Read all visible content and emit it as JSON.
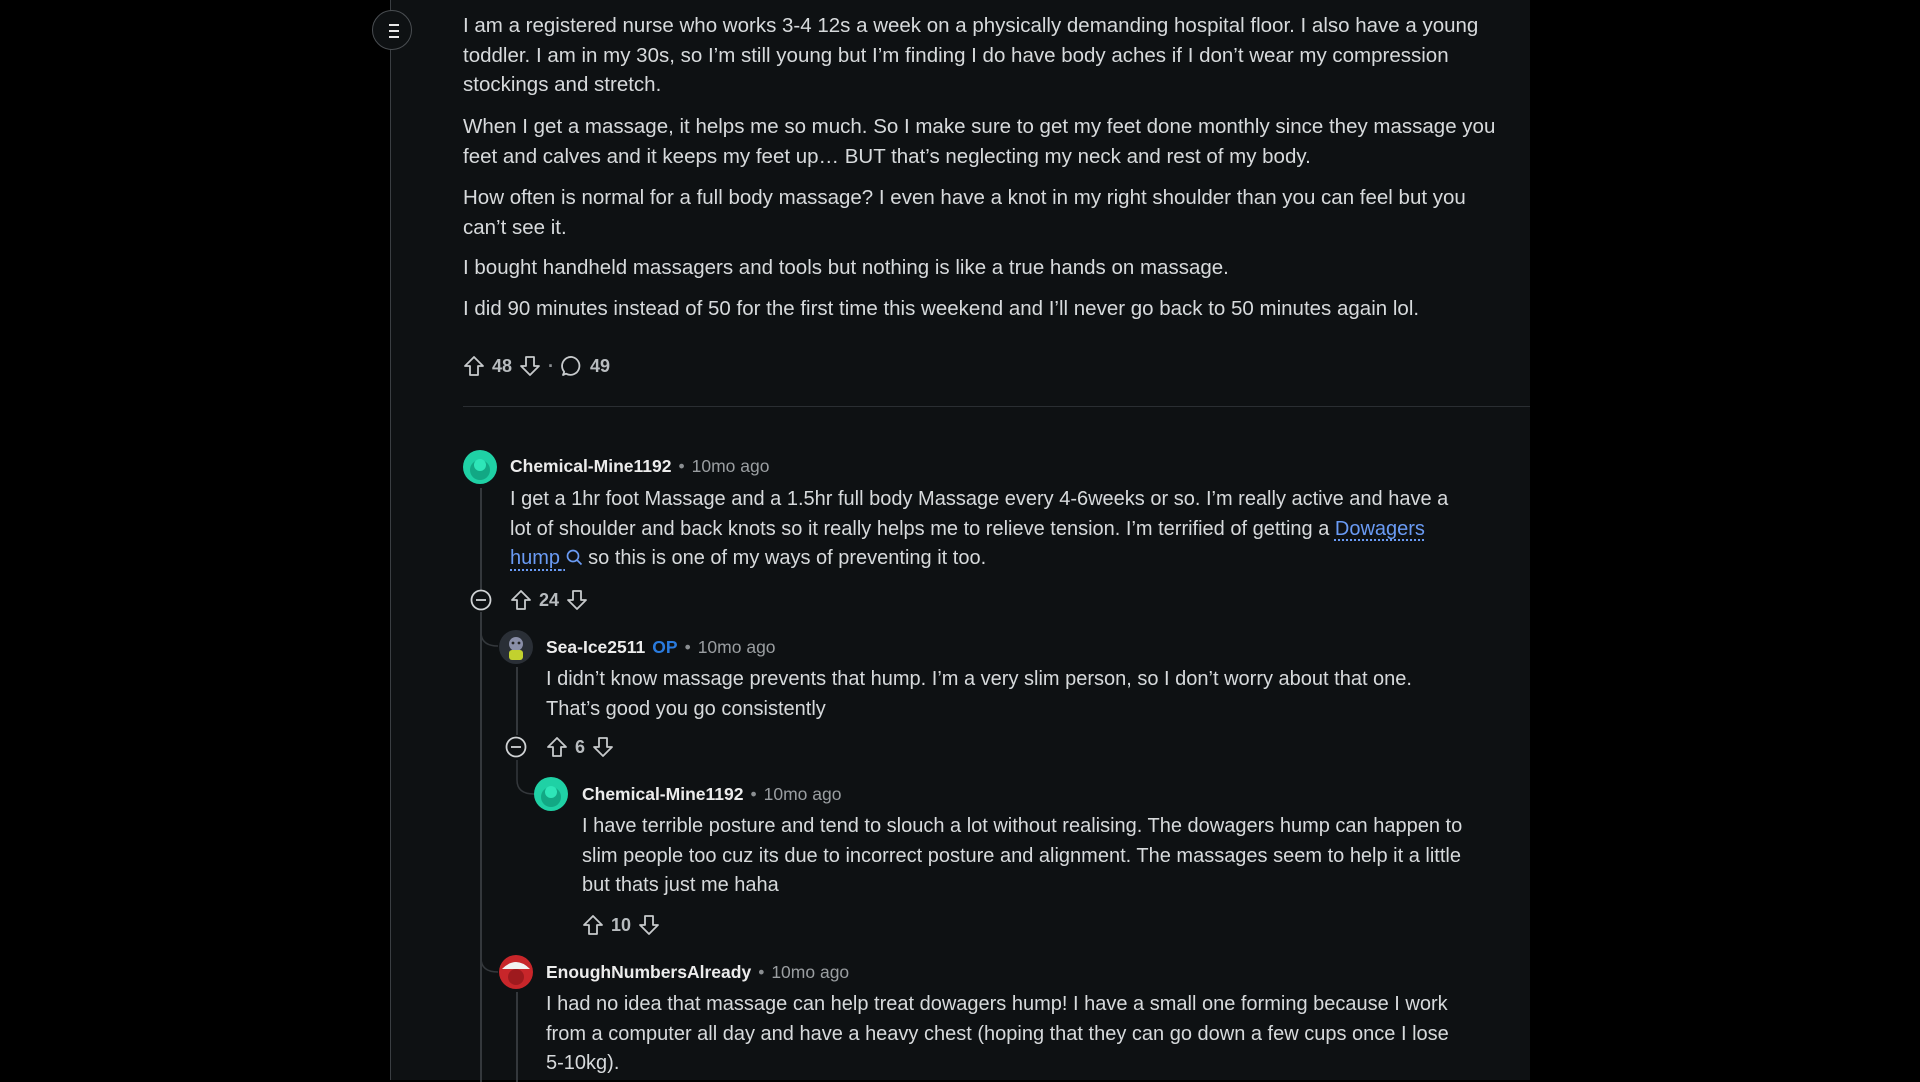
{
  "post": {
    "paragraphs": [
      [
        "I am a registered nurse who works 3-4 12s a week on a physically demanding hospital floor. I also have a young",
        "toddler. I am in my 30s, so I’m still young but I’m finding I do have body aches if I don’t wear my compression",
        "stockings and stretch."
      ],
      [
        "When I get a massage, it helps me so much. So I make sure to get my feet done monthly since they massage you",
        "feet and calves and it keeps my feet up… BUT that’s neglecting my neck and rest of my body."
      ],
      [
        "How often is normal for a full body massage? I even have a knot in my right shoulder than you can feel but you",
        "can’t see it."
      ],
      [
        "I bought handheld massagers and tools but nothing is like a true hands on massage."
      ],
      [
        "I did 90 minutes instead of 50 for the first time this weekend and I’ll never go back to 50 minutes again lol."
      ]
    ],
    "upvotes": "48",
    "separator": "·",
    "comments": "49"
  },
  "comments": [
    {
      "author": "Chemical-Mine1192",
      "time": "10mo ago",
      "lines": [
        "I get a 1hr foot Massage and a 1.5hr full body Massage every 4-6weeks or so. I’m really active and have a",
        "lot of shoulder and back knots so it really helps me to relieve tension. I’m terrified of getting a "
      ],
      "link_part1": "Dowagers",
      "link_part2": "hump",
      "line3_rest": " so this is one of my ways of preventing it too.",
      "votes": "24"
    },
    {
      "author": "Sea-Ice2511",
      "badge": "OP",
      "time": "10mo ago",
      "lines": [
        "I didn’t know massage prevents that hump. I’m a very slim person, so I don’t worry about that one.",
        "That’s good you go consistently"
      ],
      "votes": "6"
    },
    {
      "author": "Chemical-Mine1192",
      "time": "10mo ago",
      "lines": [
        "I have terrible posture and tend to slouch a lot without realising. The dowagers hump can happen to",
        "slim people too cuz its due to incorrect posture and alignment. The massages seem to help it a little",
        "but thats just me haha"
      ],
      "votes": "10"
    },
    {
      "author": "EnoughNumbersAlready",
      "time": "10mo ago",
      "lines": [
        "I had no idea that massage can help treat dowagers hump! I have a small one forming because I work",
        "from a computer all day and have a heavy chest (hoping that they can go down a few cups once I lose",
        "5-10kg)."
      ]
    }
  ],
  "meta_separator": "•",
  "colors": {
    "background": "#0e1113",
    "text": "#d7dadc",
    "link": "#6a9bf4",
    "op_badge": "#2a7bde",
    "avatar_teal": "#1fd1a5",
    "avatar_red": "#c8262a"
  },
  "icons": [
    "menu-icon",
    "upvote-icon",
    "downvote-icon",
    "comment-icon",
    "collapse-icon",
    "search-icon"
  ]
}
